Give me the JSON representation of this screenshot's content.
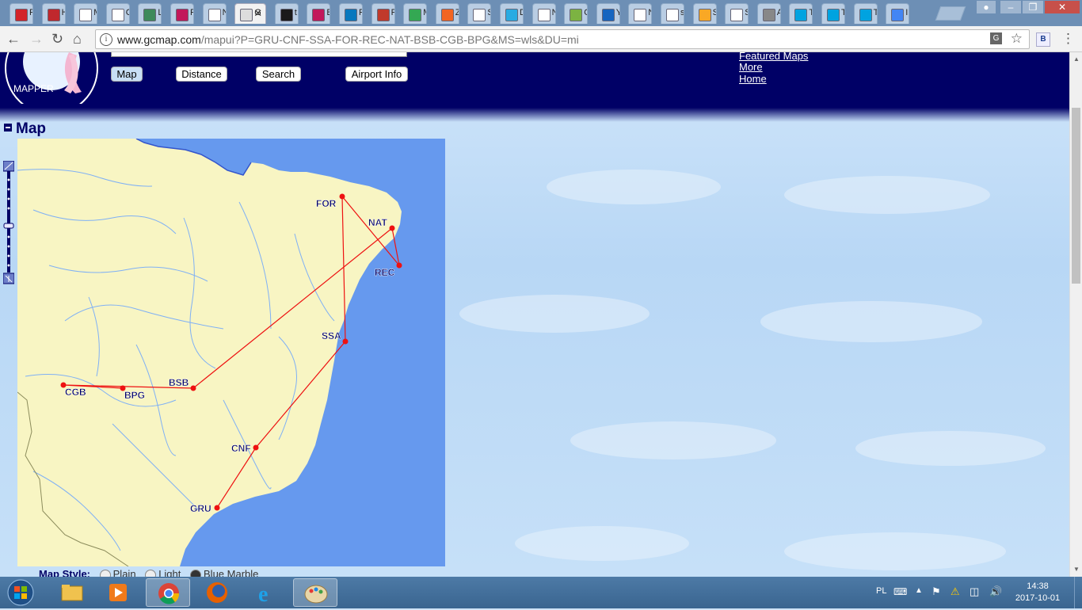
{
  "browser": {
    "url_host": "www.gcmap.com",
    "url_path": "/mapui?P=GRU-CNF-SSA-FOR-REC-NAT-BSB-CGB-BPG&MS=wls&DU=mi",
    "tabs": [
      {
        "label": "F",
        "icon": "wp-icon",
        "color": "#d3232a"
      },
      {
        "label": "H",
        "icon": "wp-icon",
        "color": "#c0282d"
      },
      {
        "label": "M",
        "icon": "olx-icon",
        "color": "#ffffff"
      },
      {
        "label": "C",
        "icon": "page-icon",
        "color": "#ffffff"
      },
      {
        "label": "L",
        "icon": "app-icon",
        "color": "#3d8a5a"
      },
      {
        "label": "F",
        "icon": "plane-icon",
        "color": "#c2185b"
      },
      {
        "label": "N",
        "icon": "page-icon",
        "color": "#ffffff"
      },
      {
        "label": "G",
        "icon": "gcmap-icon",
        "color": "#dddddd"
      },
      {
        "label": "t",
        "icon": "symfony-icon",
        "color": "#1a1a1a"
      },
      {
        "label": "E",
        "icon": "plane-icon",
        "color": "#c2185b"
      },
      {
        "label": "F",
        "icon": "drupal-icon",
        "color": "#0678be"
      },
      {
        "label": "F",
        "icon": "shield-icon",
        "color": "#c0392b"
      },
      {
        "label": "M",
        "icon": "maps-icon",
        "color": "#34a853"
      },
      {
        "label": "Z",
        "icon": "a-icon",
        "color": "#f26522"
      },
      {
        "label": "S",
        "icon": "page-icon",
        "color": "#ffffff"
      },
      {
        "label": "D",
        "icon": "cube-icon",
        "color": "#29abe2"
      },
      {
        "label": "N",
        "icon": "page-icon",
        "color": "#ffffff"
      },
      {
        "label": "C",
        "icon": "box-icon",
        "color": "#7cb342"
      },
      {
        "label": "Y",
        "icon": "n-icon",
        "color": "#1565c0"
      },
      {
        "label": "N",
        "icon": "page-icon",
        "color": "#ffffff"
      },
      {
        "label": "s",
        "icon": "page-icon",
        "color": "#ffffff"
      },
      {
        "label": "S",
        "icon": "crest-icon",
        "color": "#f9a825"
      },
      {
        "label": "S",
        "icon": "page-icon",
        "color": "#ffffff"
      },
      {
        "label": "A",
        "icon": "sound-icon",
        "color": "#888888"
      },
      {
        "label": "T",
        "icon": "wave-icon",
        "color": "#00a3e0"
      },
      {
        "label": "T",
        "icon": "wave-icon",
        "color": "#00a3e0"
      },
      {
        "label": "T",
        "icon": "wave-icon",
        "color": "#00a3e0"
      },
      {
        "label": "I",
        "icon": "google-icon",
        "color": "#4285f4"
      }
    ],
    "active_tab_index": 7,
    "window_buttons": [
      "user-icon",
      "minimize-icon",
      "restore-icon",
      "close-icon"
    ]
  },
  "header": {
    "route_input_value": "GRU-CNF-SSA-FOR-REC-NAT-BSB-CGB-BPG",
    "buttons": {
      "map": "Map",
      "distance": "Distance",
      "search": "Search",
      "airport_info": "Airport Info"
    },
    "links": {
      "featured": "Featured Maps",
      "more": "More",
      "home": "Home"
    },
    "logo_letters": "MAPPER"
  },
  "map_section": {
    "title": "Map",
    "colors": {
      "land": "#f8f5c3",
      "ocean": "#6699ee",
      "river": "#7fb0f5",
      "route": "#ee1111",
      "label": "#000066"
    },
    "airports": [
      {
        "code": "GRU"
      },
      {
        "code": "CNF"
      },
      {
        "code": "SSA"
      },
      {
        "code": "FOR"
      },
      {
        "code": "REC"
      },
      {
        "code": "NAT"
      },
      {
        "code": "BSB"
      },
      {
        "code": "CGB"
      },
      {
        "code": "BPG"
      }
    ],
    "route": [
      "GRU",
      "CNF",
      "SSA",
      "FOR",
      "REC",
      "NAT",
      "BSB",
      "CGB",
      "BPG"
    ],
    "style_label": "Map Style:",
    "styles": [
      "Plain",
      "Light",
      "Blue Marble"
    ]
  },
  "taskbar": {
    "apps": [
      "explorer-icon",
      "media-player-icon",
      "chrome-icon",
      "firefox-icon",
      "ie-icon",
      "paint-icon"
    ],
    "open_app_index": 2,
    "language": "PL",
    "time": "14:38",
    "date": "2017-10-01"
  }
}
